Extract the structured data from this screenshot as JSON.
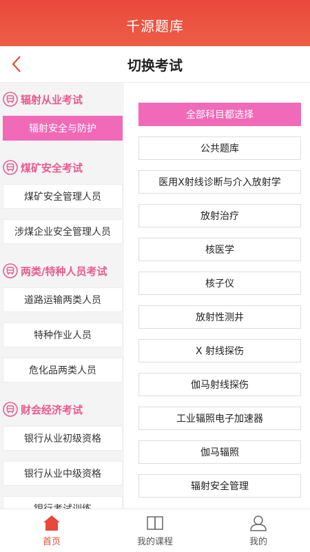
{
  "app": {
    "title": "千源题库"
  },
  "nav": {
    "title": "切换考试"
  },
  "left": {
    "groups": [
      {
        "title": "辐射从业考试",
        "items": [
          "辐射安全与防护"
        ]
      },
      {
        "title": "煤矿安全考试",
        "items": [
          "煤矿安全管理人员",
          "涉煤企业安全管理人员"
        ]
      },
      {
        "title": "两类/特种人员考试",
        "items": [
          "道路运输两类人员",
          "特种作业人员",
          "危化品两类人员"
        ]
      },
      {
        "title": "财会经济考试",
        "items": [
          "银行从业初级资格",
          "银行从业中级资格",
          "银行考试训练"
        ]
      }
    ],
    "active_item": "辐射安全与防护"
  },
  "right": {
    "select_all": "全部科目都选择",
    "items": [
      "公共题库",
      "医用X射线诊断与介入放射学",
      "放射治疗",
      "核医学",
      "核子仪",
      "放射性测井",
      "X 射线探伤",
      "伽马射线探伤",
      "工业辐照电子加速器",
      "伽马辐照",
      "辐射安全管理"
    ]
  },
  "tabbar": {
    "items": [
      {
        "label": "首页",
        "icon": "home-icon",
        "active": true
      },
      {
        "label": "我的课程",
        "icon": "book-icon",
        "active": false
      },
      {
        "label": "我的",
        "icon": "user-icon",
        "active": false
      }
    ]
  },
  "colors": {
    "header": "#e8493a",
    "accent_pink": "#f06ab8",
    "group_title": "#e85a8e"
  }
}
